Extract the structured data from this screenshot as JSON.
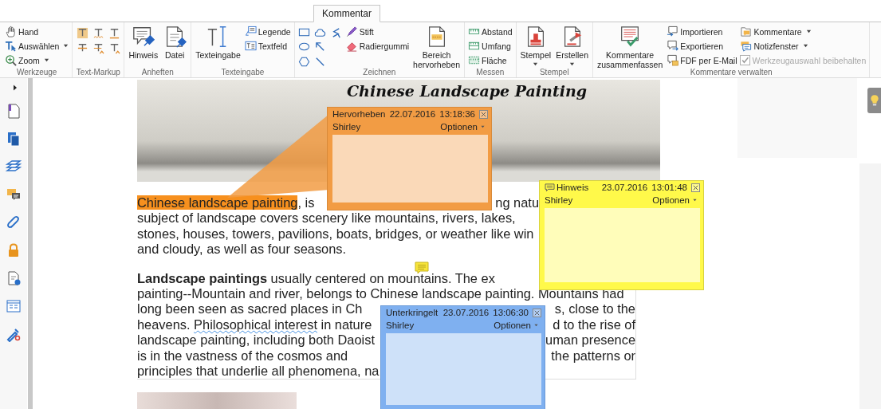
{
  "tabs": [
    {
      "label": "Kommentar",
      "selected": true
    }
  ],
  "ribbon": {
    "groups": [
      {
        "label": "Werkzeuge",
        "columns": [
          [
            {
              "kind": "small",
              "label": "Hand"
            },
            {
              "kind": "small",
              "label": "Auswählen",
              "dropdown": true
            },
            {
              "kind": "small",
              "label": "Zoom",
              "dropdown": true
            }
          ]
        ]
      },
      {
        "label": "Text-Markup",
        "columns": [
          [
            {
              "kind": "icon"
            },
            {
              "kind": "icon"
            }
          ],
          [
            {
              "kind": "icon"
            },
            {
              "kind": "icon"
            }
          ],
          [
            {
              "kind": "icon"
            },
            {
              "kind": "icon"
            }
          ]
        ]
      },
      {
        "label": "Anheften",
        "columns": [
          [
            {
              "kind": "large",
              "label": "Hinweis"
            }
          ],
          [
            {
              "kind": "large",
              "label": "Datei"
            }
          ]
        ]
      },
      {
        "label": "Texteingabe",
        "columns": [
          [
            {
              "kind": "large",
              "label": "Texteingabe"
            }
          ],
          [
            {
              "kind": "small",
              "label": "Legende"
            },
            {
              "kind": "small",
              "label": "Textfeld"
            }
          ]
        ]
      },
      {
        "label": "Zeichnen",
        "columns": [
          [
            {
              "kind": "icon"
            },
            {
              "kind": "icon"
            },
            {
              "kind": "icon"
            }
          ],
          [
            {
              "kind": "icon"
            },
            {
              "kind": "icon"
            },
            {
              "kind": "icon"
            }
          ],
          [
            {
              "kind": "icon"
            }
          ],
          [
            {
              "kind": "small",
              "label": "Stift"
            },
            {
              "kind": "small",
              "label": "Radiergummi"
            }
          ],
          [
            {
              "kind": "large",
              "label": "Bereich\nhervorheben"
            }
          ]
        ]
      },
      {
        "label": "Messen",
        "columns": [
          [
            {
              "kind": "small",
              "label": "Abstand"
            },
            {
              "kind": "small",
              "label": "Umfang"
            },
            {
              "kind": "small",
              "label": "Fläche"
            }
          ]
        ]
      },
      {
        "label": "Stempel",
        "columns": [
          [
            {
              "kind": "large",
              "label": "Stempel",
              "dropdown": true
            }
          ],
          [
            {
              "kind": "large",
              "label": "Erstellen",
              "dropdown": true
            }
          ]
        ]
      },
      {
        "label": "Kommentare verwalten",
        "columns": [
          [
            {
              "kind": "large",
              "label": "Kommentare\nzusammenfassen"
            }
          ],
          [
            {
              "kind": "small",
              "label": "Importieren"
            },
            {
              "kind": "small",
              "label": "Exportieren"
            },
            {
              "kind": "small",
              "label": "FDF per E-Mail"
            }
          ],
          [
            {
              "kind": "small",
              "label": "Kommentare",
              "dropdown": true
            },
            {
              "kind": "small",
              "label": "Notizfenster",
              "dropdown": true
            },
            {
              "kind": "check",
              "label": "Werkzeugauswahl beibehalten",
              "checked": true,
              "disabled": true
            }
          ]
        ]
      }
    ]
  },
  "document": {
    "banner_title": "Chinese Landscape Painting",
    "paragraphs": [
      {
        "lines": [
          {
            "left": [
              {
                "kind": "highlight",
                "text": "Chinese landscape painting"
              },
              {
                "kind": "plain",
                "text": ", is"
              }
            ],
            "right": [
              {
                "kind": "plain",
                "text": "ng natu"
              }
            ]
          },
          {
            "left": [
              {
                "kind": "plain",
                "text": "subject of landscape covers scenery like mountains, rivers, lakes,"
              }
            ]
          },
          {
            "left": [
              {
                "kind": "plain",
                "text": "stones, houses, towers, pavilions, boats, bridges, or weather like win"
              }
            ]
          },
          {
            "left": [
              {
                "kind": "plain",
                "text": "and cloudy, as well as four seasons."
              }
            ]
          }
        ]
      },
      {
        "lines": [
          {
            "left": [
              {
                "kind": "bold",
                "text": "Landscape paintings"
              },
              {
                "kind": "plain",
                "text": " usually centered on mountains. The ex"
              }
            ]
          },
          {
            "left": [
              {
                "kind": "plain",
                "text": "painting--Mountain and river, belongs to Chinese landscape painting. Mountains had"
              }
            ]
          },
          {
            "left": [
              {
                "kind": "plain",
                "text": "long been seen as sacred places in Ch"
              }
            ],
            "right": [
              {
                "kind": "plain",
                "text": "s, close to the"
              }
            ]
          },
          {
            "left": [
              {
                "kind": "plain",
                "text": "heavens. "
              },
              {
                "kind": "squiggly",
                "text": "Philosophical interest"
              },
              {
                "kind": "plain",
                "text": " in nature"
              }
            ],
            "right": [
              {
                "kind": "plain",
                "text": "d to the rise of"
              }
            ]
          },
          {
            "left": [
              {
                "kind": "plain",
                "text": "landscape painting, including both Daoist"
              }
            ],
            "right": [
              {
                "kind": "plain",
                "text": "uman presence"
              }
            ]
          },
          {
            "left": [
              {
                "kind": "plain",
                "text": "is in the vastness of the cosmos and"
              }
            ],
            "right": [
              {
                "kind": "plain",
                "text": "the patterns or"
              }
            ]
          },
          {
            "left": [
              {
                "kind": "plain",
                "text": "principles that underlie all phenomena, na"
              }
            ]
          }
        ]
      }
    ]
  },
  "notes": [
    {
      "kind": "highlight",
      "type": "Hervorheben",
      "date": "22.07.2016",
      "time": "13:18:36",
      "author": "Shirley",
      "options": "Optionen",
      "color": "#f29c44"
    },
    {
      "kind": "note",
      "type": "Hinweis",
      "date": "23.07.2016",
      "time": "13:01:48",
      "author": "Shirley",
      "options": "Optionen",
      "color": "#fff94a"
    },
    {
      "kind": "squiggly",
      "type": "Unterkringelt",
      "date": "23.07.2016",
      "time": "13:06:30",
      "author": "Shirley",
      "options": "Optionen",
      "color": "#7fb0f0"
    }
  ]
}
